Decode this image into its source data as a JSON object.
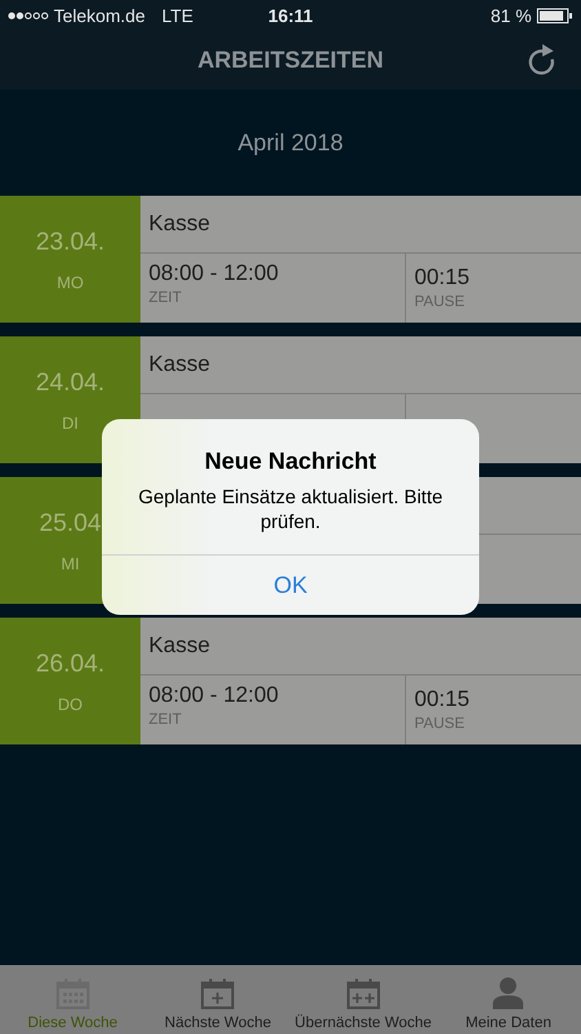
{
  "status_bar": {
    "carrier": "Telekom.de",
    "network": "LTE",
    "time": "16:11",
    "battery": "81 %"
  },
  "header": {
    "title": "ARBEITSZEITEN"
  },
  "month": "April 2018",
  "days": [
    {
      "date": "23.04.",
      "weekday": "MO",
      "task": "Kasse",
      "time": "08:00 - 12:00",
      "time_label": "ZEIT",
      "pause": "00:15",
      "pause_label": "PAUSE"
    },
    {
      "date": "24.04.",
      "weekday": "DI",
      "task": "Kasse"
    },
    {
      "date": "25.04",
      "weekday": "MI"
    },
    {
      "date": "26.04.",
      "weekday": "DO",
      "task": "Kasse",
      "time": "08:00 - 12:00",
      "time_label": "ZEIT",
      "pause": "00:15",
      "pause_label": "PAUSE"
    }
  ],
  "alert": {
    "title": "Neue Nachricht",
    "message": "Geplante Einsätze aktualisiert. Bitte prüfen.",
    "button": "OK"
  },
  "tabs": [
    {
      "label": "Diese Woche",
      "kind": "grid",
      "selected": true
    },
    {
      "label": "Nächste Woche",
      "kind": "plus",
      "selected": false
    },
    {
      "label": "Übernächste Woche",
      "kind": "plusplus",
      "selected": false
    },
    {
      "label": "Meine Daten",
      "kind": "person",
      "selected": false
    }
  ]
}
